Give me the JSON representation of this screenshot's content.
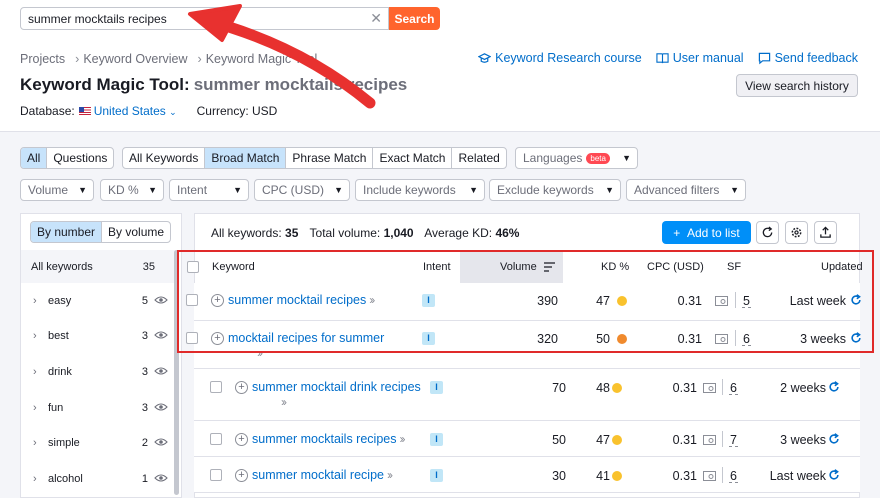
{
  "search": {
    "value": "summer mocktails recipes",
    "button": "Search"
  },
  "breadcrumb": {
    "items": [
      "Projects",
      "Keyword Overview",
      "Keyword Magic Tool"
    ]
  },
  "top_links": {
    "course": "Keyword Research course",
    "manual": "User manual",
    "feedback": "Send feedback"
  },
  "header": {
    "title": "Keyword Magic Tool:",
    "keyword": "summer mocktails recipes",
    "history_button": "View search history"
  },
  "database": {
    "label": "Database:",
    "country": "United States",
    "currency": "Currency: USD"
  },
  "filters": {
    "seg_all": "All",
    "seg_questions": "Questions",
    "seg_all_keywords": "All Keywords",
    "seg_broad": "Broad Match",
    "seg_phrase": "Phrase Match",
    "seg_exact": "Exact Match",
    "seg_related": "Related",
    "languages": "Languages",
    "beta": "beta",
    "volume": "Volume",
    "kd": "KD %",
    "intent": "Intent",
    "cpc": "CPC (USD)",
    "include": "Include keywords",
    "exclude": "Exclude keywords",
    "advanced": "Advanced filters"
  },
  "sidebar": {
    "by_number": "By number",
    "by_volume": "By volume",
    "all_label": "All keywords",
    "all_count": "35",
    "items": [
      {
        "word": "easy",
        "count": "5"
      },
      {
        "word": "best",
        "count": "3"
      },
      {
        "word": "drink",
        "count": "3"
      },
      {
        "word": "fun",
        "count": "3"
      },
      {
        "word": "simple",
        "count": "2"
      },
      {
        "word": "alcohol",
        "count": "1"
      }
    ]
  },
  "summary": {
    "all_label": "All keywords:",
    "all_value": "35",
    "vol_label": "Total volume:",
    "vol_value": "1,040",
    "kd_label": "Average KD:",
    "kd_value": "46%",
    "add_button": "Add to list"
  },
  "table": {
    "headers": {
      "keyword": "Keyword",
      "intent": "Intent",
      "volume": "Volume",
      "kd": "KD %",
      "cpc": "CPC (USD)",
      "sf": "SF",
      "updated": "Updated"
    },
    "rows": [
      {
        "keyword": "summer mocktail recipes",
        "intent": "I",
        "volume": "390",
        "kd": "47",
        "kd_color": "#f9c22d",
        "cpc": "0.31",
        "sf": "5",
        "updated": "Last week"
      },
      {
        "keyword": "mocktail recipes for summer",
        "intent": "I",
        "volume": "320",
        "kd": "50",
        "kd_color": "#f08a2d",
        "cpc": "0.31",
        "sf": "6",
        "updated": "3 weeks"
      },
      {
        "keyword": "summer mocktail drink recipes",
        "intent": "I",
        "volume": "70",
        "kd": "48",
        "kd_color": "#f9c22d",
        "cpc": "0.31",
        "sf": "6",
        "updated": "2 weeks"
      },
      {
        "keyword": "summer mocktails recipes",
        "intent": "I",
        "volume": "50",
        "kd": "47",
        "kd_color": "#f9c22d",
        "cpc": "0.31",
        "sf": "7",
        "updated": "3 weeks"
      },
      {
        "keyword": "summer mocktail recipe",
        "intent": "I",
        "volume": "30",
        "kd": "41",
        "kd_color": "#f9c22d",
        "cpc": "0.31",
        "sf": "6",
        "updated": "Last week"
      }
    ]
  },
  "colors": {
    "accent": "#ff642d",
    "link": "#006dca",
    "primary": "#008ff8",
    "highlight": "#e02a2a"
  }
}
